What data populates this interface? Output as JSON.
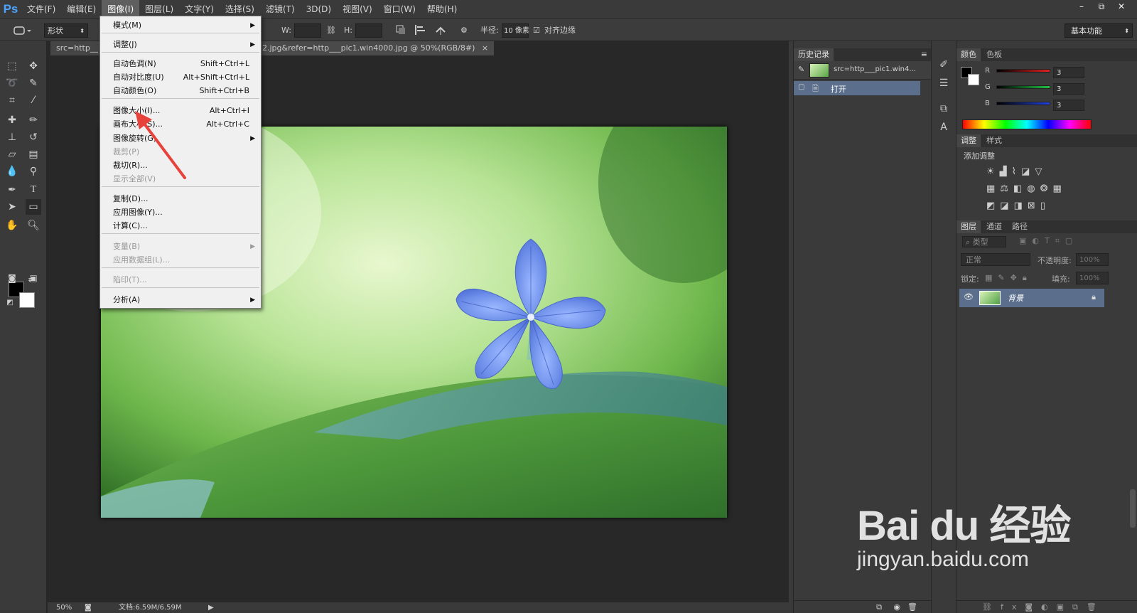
{
  "menubar": {
    "logo": "Ps",
    "items": [
      "文件(F)",
      "编辑(E)",
      "图像(I)",
      "图层(L)",
      "文字(Y)",
      "选择(S)",
      "滤镜(T)",
      "3D(D)",
      "视图(V)",
      "窗口(W)",
      "帮助(H)"
    ],
    "active_index": 2,
    "window_controls": [
      "–",
      "⧉",
      "✕"
    ]
  },
  "options": {
    "shape_mode": "形状",
    "w_label": "W:",
    "h_label": "H:",
    "radius_label": "半径:",
    "radius_value": "10 像素",
    "align_edges_label": "对齐边缘",
    "align_edges_checked": true,
    "workspace": "基本功能"
  },
  "document": {
    "tab_partial_left": "src=http__",
    "tab_partial_right": "2.jpg&refer=http___pic1.win4000.jpg @ 50%(RGB/8#)",
    "tab_close": "×",
    "zoom": "50%",
    "doc_size": "文档:6.59M/6.59M"
  },
  "image_menu": {
    "items": [
      {
        "label": "模式(M)",
        "shortcut": "",
        "submenu": true,
        "disabled": false
      },
      {
        "label": "调整(J)",
        "shortcut": "",
        "submenu": true,
        "disabled": false
      },
      {
        "label": "自动色调(N)",
        "shortcut": "Shift+Ctrl+L",
        "submenu": false,
        "disabled": false
      },
      {
        "label": "自动对比度(U)",
        "shortcut": "Alt+Shift+Ctrl+L",
        "submenu": false,
        "disabled": false
      },
      {
        "label": "自动颜色(O)",
        "shortcut": "Shift+Ctrl+B",
        "submenu": false,
        "disabled": false
      },
      {
        "label": "图像大小(I)...",
        "shortcut": "Alt+Ctrl+I",
        "submenu": false,
        "disabled": false
      },
      {
        "label": "画布大小(S)...",
        "shortcut": "Alt+Ctrl+C",
        "submenu": false,
        "disabled": false
      },
      {
        "label": "图像旋转(G)",
        "shortcut": "",
        "submenu": true,
        "disabled": false
      },
      {
        "label": "裁剪(P)",
        "shortcut": "",
        "submenu": false,
        "disabled": true
      },
      {
        "label": "裁切(R)...",
        "shortcut": "",
        "submenu": false,
        "disabled": false
      },
      {
        "label": "显示全部(V)",
        "shortcut": "",
        "submenu": false,
        "disabled": true
      },
      {
        "label": "复制(D)...",
        "shortcut": "",
        "submenu": false,
        "disabled": false
      },
      {
        "label": "应用图像(Y)...",
        "shortcut": "",
        "submenu": false,
        "disabled": false
      },
      {
        "label": "计算(C)...",
        "shortcut": "",
        "submenu": false,
        "disabled": false
      },
      {
        "label": "变量(B)",
        "shortcut": "",
        "submenu": true,
        "disabled": true
      },
      {
        "label": "应用数据组(L)...",
        "shortcut": "",
        "submenu": false,
        "disabled": true
      },
      {
        "label": "陷印(T)...",
        "shortcut": "",
        "submenu": false,
        "disabled": true
      },
      {
        "label": "分析(A)",
        "shortcut": "",
        "submenu": true,
        "disabled": false
      }
    ]
  },
  "history": {
    "title": "历史记录",
    "snapshot": "src=http___pic1.win4...",
    "states": [
      "打开"
    ]
  },
  "color_panel": {
    "tabs": [
      "颜色",
      "色板"
    ],
    "channels": [
      {
        "name": "R",
        "value": "3",
        "color": "#e02020"
      },
      {
        "name": "G",
        "value": "3",
        "color": "#20c040"
      },
      {
        "name": "B",
        "value": "3",
        "color": "#2040e0"
      }
    ]
  },
  "adjust_panel": {
    "tabs": [
      "调整",
      "样式"
    ],
    "heading": "添加调整"
  },
  "layers_panel": {
    "tabs": [
      "图层",
      "通道",
      "路径"
    ],
    "filter": "类型",
    "blend_mode": "正常",
    "opacity_label": "不透明度:",
    "opacity_value": "100%",
    "lock_label": "锁定:",
    "fill_label": "填充:",
    "fill_value": "100%",
    "layers": [
      {
        "name": "背景",
        "visible": true,
        "locked": true
      }
    ]
  },
  "watermark": {
    "logo": "Bai du 经验",
    "sub": "jingyan.baidu.com"
  }
}
